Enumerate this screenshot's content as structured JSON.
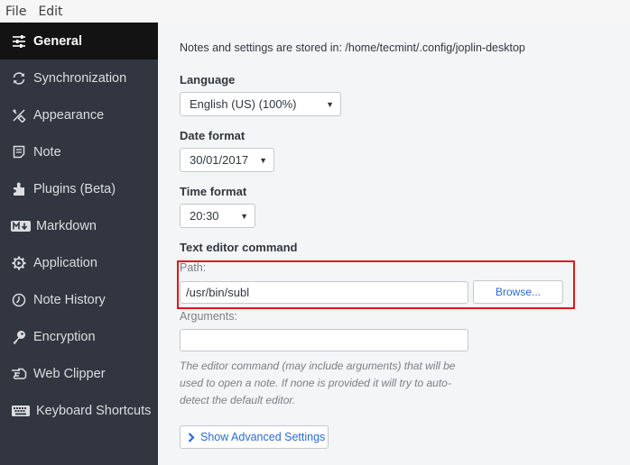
{
  "menubar": {
    "items": [
      "File",
      "Edit"
    ]
  },
  "sidebar": {
    "active": "General",
    "items": [
      {
        "label": "General",
        "icon": "sliders-icon"
      },
      {
        "label": "Synchronization",
        "icon": "sync-icon"
      },
      {
        "label": "Appearance",
        "icon": "paint-tools-icon"
      },
      {
        "label": "Note",
        "icon": "note-icon"
      },
      {
        "label": "Plugins (Beta)",
        "icon": "puzzle-icon"
      },
      {
        "label": "Markdown",
        "icon": "markdown-icon"
      },
      {
        "label": "Application",
        "icon": "gear-icon"
      },
      {
        "label": "Note History",
        "icon": "clock-icon"
      },
      {
        "label": "Encryption",
        "icon": "key-icon"
      },
      {
        "label": "Web Clipper",
        "icon": "hand-pointer-icon"
      },
      {
        "label": "Keyboard Shortcuts",
        "icon": "keyboard-icon"
      }
    ]
  },
  "main": {
    "storage_note": "Notes and settings are stored in: /home/tecmint/.config/joplin-desktop",
    "language": {
      "label": "Language",
      "value": "English (US) (100%)"
    },
    "date_format": {
      "label": "Date format",
      "value": "30/01/2017"
    },
    "time_format": {
      "label": "Time format",
      "value": "20:30"
    },
    "text_editor": {
      "label": "Text editor command",
      "path_label": "Path:",
      "path_value": "/usr/bin/subl",
      "browse_label": "Browse...",
      "arguments_label": "Arguments:",
      "arguments_value": "",
      "help_text": "The editor command (may include arguments) that will be used to open a note. If none is provided it will try to auto-detect the default editor."
    },
    "advanced_button_label": "Show Advanced Settings"
  },
  "colors": {
    "sidebar_bg": "#313640",
    "sidebar_active_bg": "#131313",
    "accent_link": "#2b6bd6",
    "highlight_annotation": "#e3151a"
  }
}
